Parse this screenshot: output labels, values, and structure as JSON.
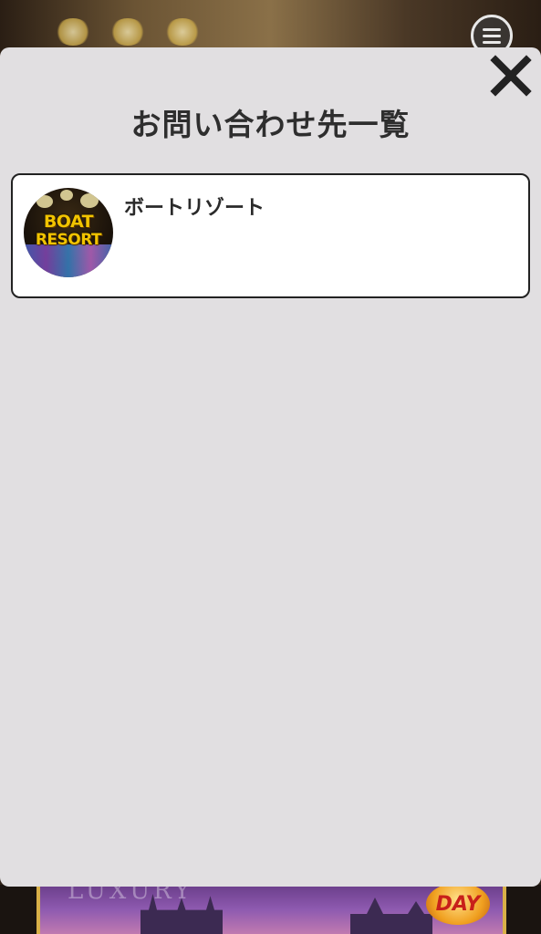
{
  "background": {
    "menu_icon": "hamburger-menu-icon",
    "banner_word": "LUXURY",
    "banner_badge": "DAY"
  },
  "modal": {
    "title": "お問い合わせ先一覧",
    "close_icon": "close-x-icon",
    "contacts": [
      {
        "name": "ボートリゾート",
        "logo_line1": "BOAT",
        "logo_line2": "RESORT"
      }
    ]
  },
  "colors": {
    "modal_bg": "#e1dfe1",
    "card_bg": "#ffffff",
    "card_border": "#222222",
    "text": "#2e2e2e"
  }
}
